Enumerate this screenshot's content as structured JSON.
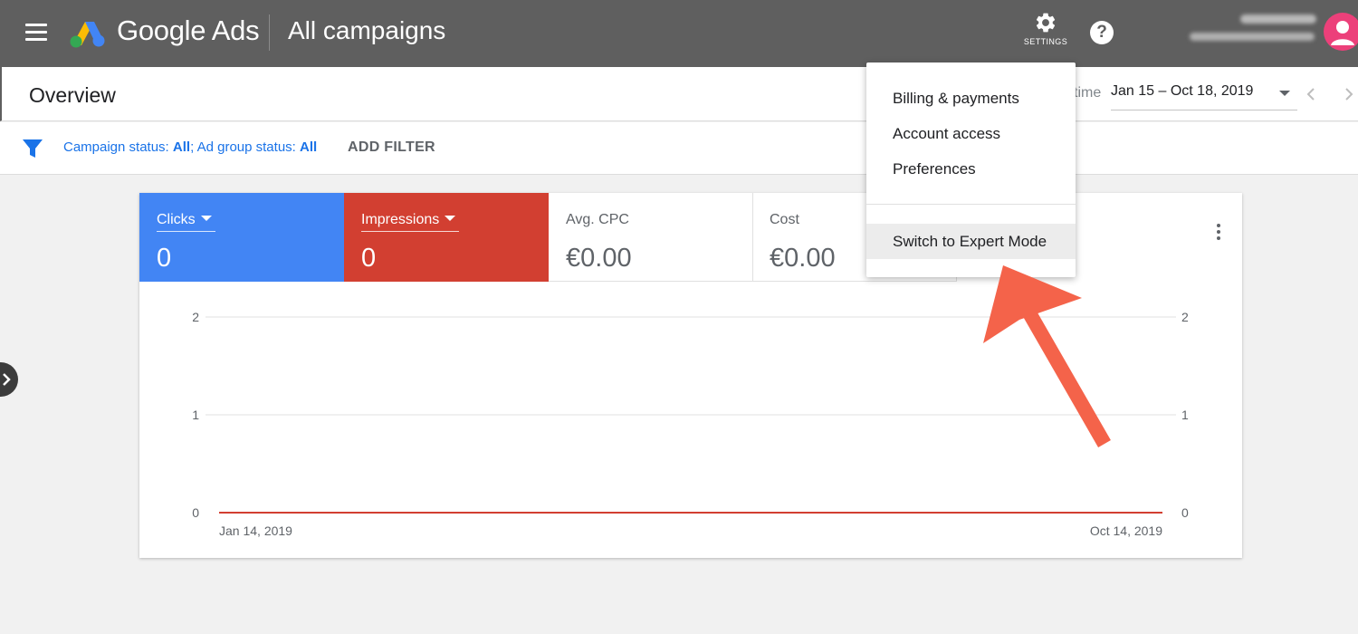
{
  "header": {
    "brand": "Google Ads",
    "page_heading": "All campaigns",
    "settings_label": "SETTINGS",
    "help_glyph": "?",
    "menu_icon": "hamburger-icon",
    "logo_icon": "google-ads-logo",
    "settings_icon": "gear-icon",
    "help_icon": "help-circle-icon"
  },
  "overview": {
    "title": "Overview",
    "date_hint": "time",
    "date_range": "Jan 15 – Oct 18, 2019"
  },
  "filter": {
    "campaign_prefix": "Campaign status: ",
    "campaign_value": "All",
    "separator": "; ",
    "adgroup_prefix": "Ad group status: ",
    "adgroup_value": "All",
    "add_filter": "ADD FILTER"
  },
  "metrics": [
    {
      "name": "Clicks",
      "value": "0",
      "color": "#4285f4"
    },
    {
      "name": "Impressions",
      "value": "0",
      "color": "#d23f31"
    },
    {
      "name": "Avg. CPC",
      "value": "€0.00"
    },
    {
      "name": "Cost",
      "value": "€0.00"
    }
  ],
  "settings_menu": {
    "items": [
      "Billing & payments",
      "Account access",
      "Preferences"
    ],
    "expert_mode": "Switch to Expert Mode"
  },
  "chart_data": {
    "type": "line",
    "x": [
      "Jan 14, 2019",
      "Oct 14, 2019"
    ],
    "y_ticks": [
      0,
      1,
      2
    ],
    "ylim": [
      0,
      2
    ],
    "series": [
      {
        "values": [
          0,
          0
        ],
        "color": "#4285f4"
      },
      {
        "values": [
          0,
          0
        ],
        "color": "#d23f31"
      }
    ],
    "grid": true
  }
}
